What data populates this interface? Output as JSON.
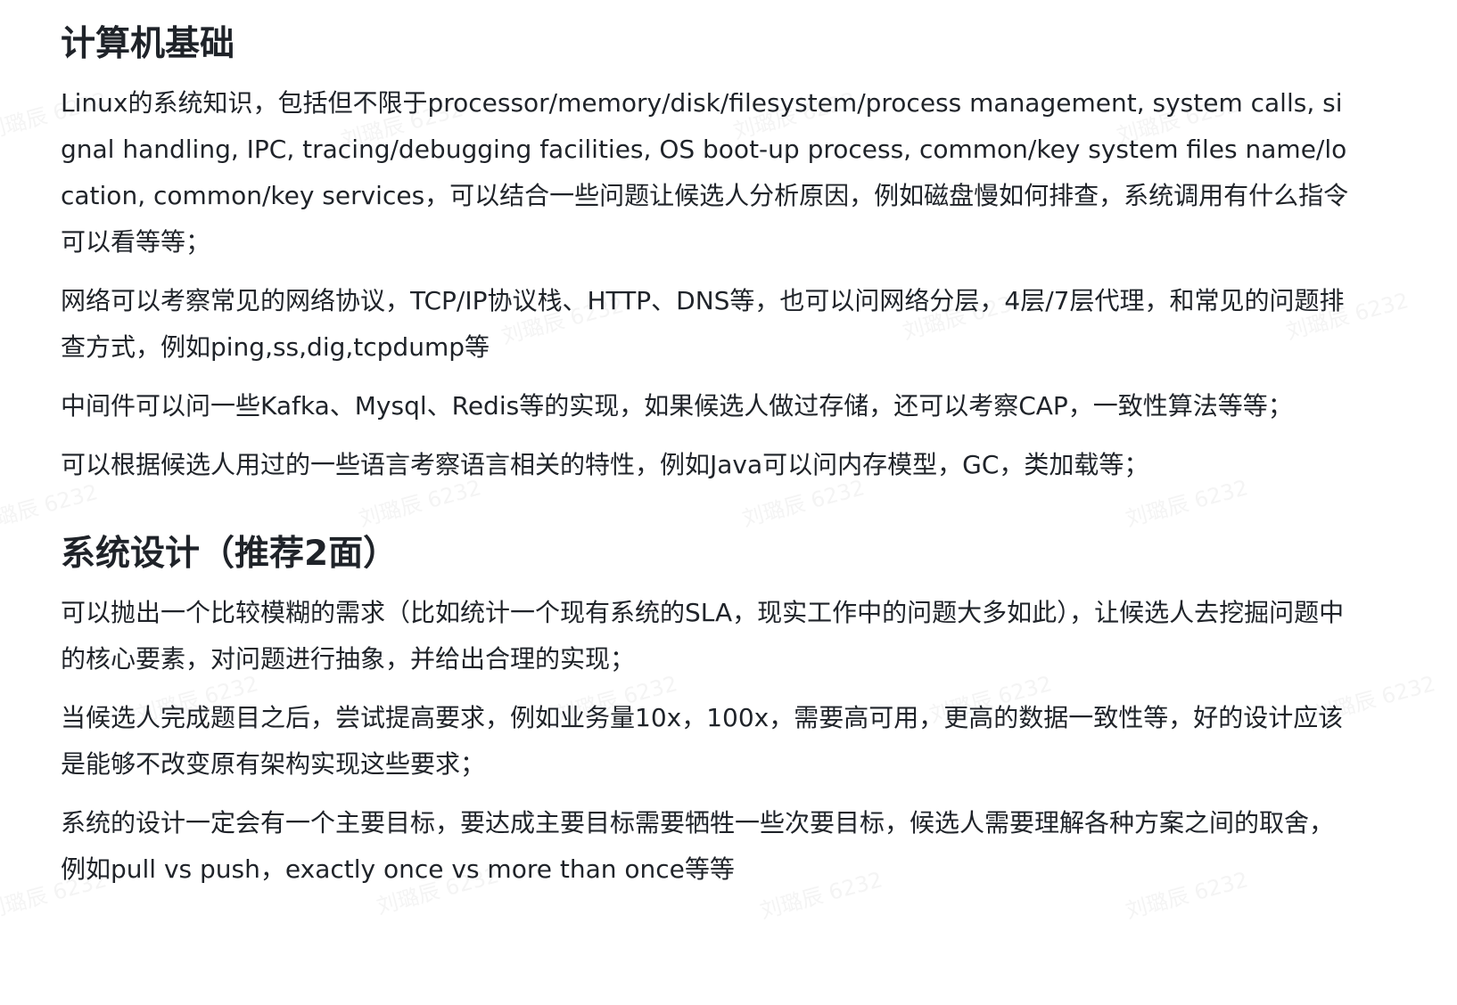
{
  "sections": [
    {
      "heading": "计算机基础",
      "paragraphs": [
        "Linux的系统知识，包括但不限于processor/memory/disk/filesystem/process management, system calls, signal handling, IPC, tracing/debugging facilities, OS boot-up process, common/key system files name/location, common/key services，可以结合一些问题让候选人分析原因，例如磁盘慢如何排查，系统调用有什么指令可以看等等；",
        "网络可以考察常见的网络协议，TCP/IP协议栈、HTTP、DNS等，也可以问网络分层，4层/7层代理，和常见的问题排查方式，例如ping,ss,dig,tcpdump等",
        "中间件可以问一些Kafka、Mysql、Redis等的实现，如果候选人做过存储，还可以考察CAP，一致性算法等等；",
        "可以根据候选人用过的一些语言考察语言相关的特性，例如Java可以问内存模型，GC，类加载等；"
      ]
    },
    {
      "heading": "系统设计（推荐2面）",
      "paragraphs": [
        "可以抛出一个比较模糊的需求（比如统计一个现有系统的SLA，现实工作中的问题大多如此），让候选人去挖掘问题中的核心要素，对问题进行抽象，并给出合理的实现；",
        "当候选人完成题目之后，尝试提高要求，例如业务量10x，100x，需要高可用，更高的数据一致性等，好的设计应该是能够不改变原有架构实现这些要求；",
        "系统的设计一定会有一个主要目标，要达成主要目标需要牺牲一些次要目标，候选人需要理解各种方案之间的取舍，例如pull vs push，exactly once vs more than once等等"
      ]
    }
  ],
  "watermark": "刘璐辰 6232"
}
